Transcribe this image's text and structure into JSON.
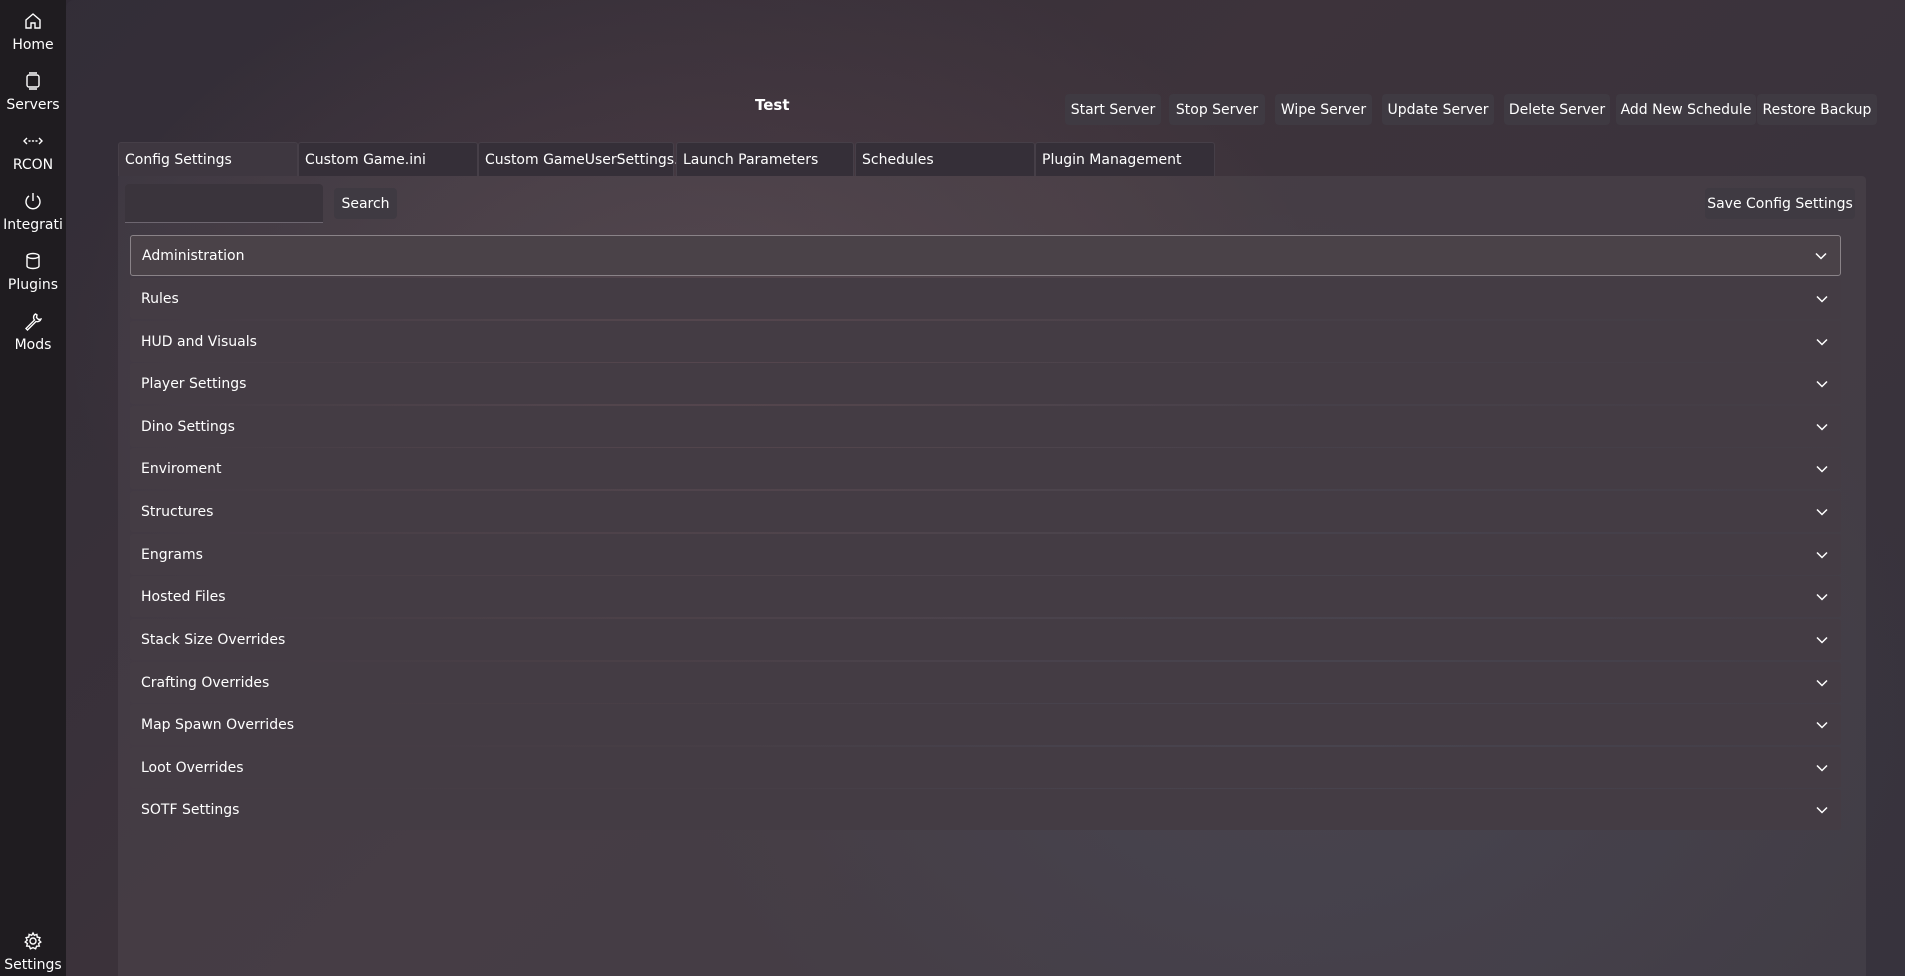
{
  "sidebar": {
    "items": [
      {
        "label": "Home",
        "icon": "home-icon"
      },
      {
        "label": "Servers",
        "icon": "servers-icon"
      },
      {
        "label": "RCON",
        "icon": "rcon-icon"
      },
      {
        "label": "Integrati",
        "icon": "power-icon"
      },
      {
        "label": "Plugins",
        "icon": "database-icon"
      },
      {
        "label": "Mods",
        "icon": "wrench-icon"
      }
    ],
    "settings_label": "Settings"
  },
  "header": {
    "title": "Test",
    "buttons": [
      "Start Server",
      "Stop Server",
      "Wipe Server",
      "Update Server",
      "Delete Server",
      "Add New Schedule",
      "Restore Backup"
    ]
  },
  "tabs": [
    "Config Settings",
    "Custom Game.ini",
    "Custom GameUserSettings.ini",
    "Launch Parameters",
    "Schedules",
    "Plugin Management"
  ],
  "active_tab": "Config Settings",
  "toolbar": {
    "search_value": "",
    "search_label": "Search",
    "save_label": "Save Config Settings"
  },
  "sections": [
    "Administration",
    "Rules",
    "HUD and Visuals",
    "Player Settings",
    "Dino Settings",
    "Enviroment",
    "Structures",
    "Engrams",
    "Hosted Files",
    "Stack Size Overrides",
    "Crafting Overrides",
    "Map Spawn Overrides",
    "Loot Overrides",
    "SOTF Settings"
  ]
}
